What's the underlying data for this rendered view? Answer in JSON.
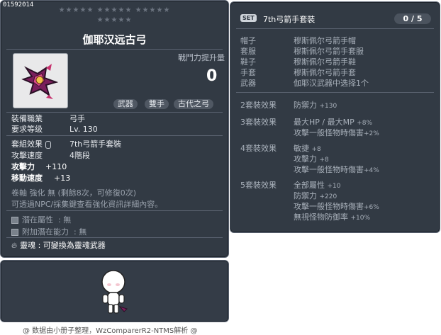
{
  "item": {
    "code": "01592014",
    "stars_row1": "★★★★★ ★★★★★ ★★★★★",
    "stars_row2": "★★★★★",
    "title": "伽耶汉远古弓",
    "power_label": "戰鬥力提升量",
    "power_value": "0",
    "tags": [
      "武器",
      "雙手",
      "古代之弓"
    ],
    "job_label": "裝備職業",
    "job_value": "弓手",
    "level_label": "要求等级",
    "level_value": "Lv. 130",
    "set_label": "套組效果",
    "set_value": "7th弓箭手套裝",
    "speed_label": "攻擊速度",
    "speed_value": "4階段",
    "atk_label": "攻擊力",
    "atk_value": "+110",
    "move_label": "移動速度",
    "move_value": "+13",
    "scroll_line": "卷軸 強化 無 (剩餘8次，可修復0次)",
    "npc_line": "可透過NPC/採集鍵查看強化資訊詳細內容。",
    "potential_label": "潛在屬性",
    "potential_value": "無",
    "add_potential_label": "附加潛在能力",
    "add_potential_value": "無",
    "soul_label": "靈魂",
    "soul_value": "可變換為靈魂武器"
  },
  "set": {
    "badge": "SET",
    "name": "7th弓箭手套裝",
    "count": "0 / 5",
    "pieces": [
      {
        "slot": "帽子",
        "name": "穆斯佩尔弓箭手帽"
      },
      {
        "slot": "套服",
        "name": "穆斯佩尔弓箭手套服"
      },
      {
        "slot": "鞋子",
        "name": "穆斯佩尔弓箭手鞋"
      },
      {
        "slot": "手套",
        "name": "穆斯佩尔弓箭手套"
      },
      {
        "slot": "武器",
        "name": "伽耶汉武器中选择1个"
      }
    ],
    "effects": [
      {
        "label": "2套裝效果",
        "lines": [
          {
            "stat": "防禦力",
            "value": "+130"
          }
        ]
      },
      {
        "label": "3套裝效果",
        "lines": [
          {
            "stat": "最大HP / 最大MP",
            "value": "+8%"
          },
          {
            "stat": "攻擊一般怪物時傷害",
            "value": "+2%"
          }
        ]
      },
      {
        "label": "4套裝效果",
        "lines": [
          {
            "stat": "敏捷",
            "value": "+8"
          },
          {
            "stat": "攻擊力",
            "value": "+8"
          },
          {
            "stat": "攻擊一般怪物時傷害",
            "value": "+4%"
          }
        ]
      },
      {
        "label": "5套裝效果",
        "lines": [
          {
            "stat": "全部屬性",
            "value": "+10"
          },
          {
            "stat": "防禦力",
            "value": "+220"
          },
          {
            "stat": "攻擊一般怪物時傷害",
            "value": "+6%"
          },
          {
            "stat": "無視怪物防御率",
            "value": "+10%"
          }
        ]
      }
    ]
  },
  "footer": "@ 数据由小册子整理，WzComparerR2-NTMS解析 @"
}
